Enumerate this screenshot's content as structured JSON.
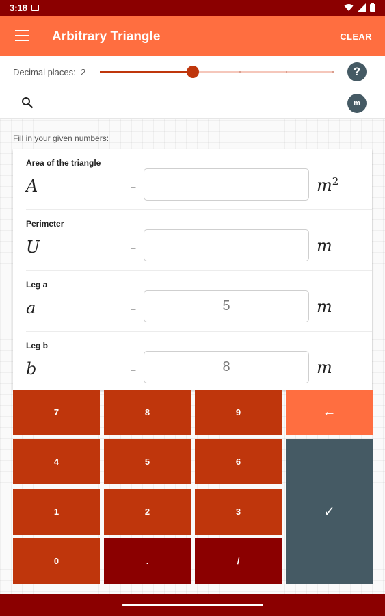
{
  "status_bar": {
    "time": "3:18"
  },
  "app_bar": {
    "title": "Arbitrary Triangle",
    "clear_label": "CLEAR"
  },
  "decimals": {
    "label": "Decimal places:",
    "value": "2",
    "min": 0,
    "max": 5,
    "current": 2
  },
  "help_button": {
    "label": "?"
  },
  "search": {
    "value": "",
    "placeholder": ""
  },
  "unit_button": {
    "label": "m"
  },
  "fill_label": "Fill in your given numbers:",
  "fields": [
    {
      "label": "Area of the triangle",
      "symbol": "A",
      "equals": "=",
      "value": "",
      "unit": "m",
      "unit_exp": "2"
    },
    {
      "label": "Perimeter",
      "symbol": "U",
      "equals": "=",
      "value": "",
      "unit": "m",
      "unit_exp": ""
    },
    {
      "label": "Leg a",
      "symbol": "a",
      "equals": "=",
      "value": "5",
      "unit": "m",
      "unit_exp": ""
    },
    {
      "label": "Leg b",
      "symbol": "b",
      "equals": "=",
      "value": "8",
      "unit": "m",
      "unit_exp": ""
    }
  ],
  "keypad": {
    "keys": [
      "7",
      "8",
      "9",
      "4",
      "5",
      "6",
      "1",
      "2",
      "3",
      "0",
      ".",
      "/"
    ],
    "backspace": "←",
    "confirm": "✓"
  },
  "colors": {
    "primary": "#ff6e40",
    "primary_dark": "#8b0000",
    "key": "#bf360c",
    "accent": "#455a64"
  }
}
